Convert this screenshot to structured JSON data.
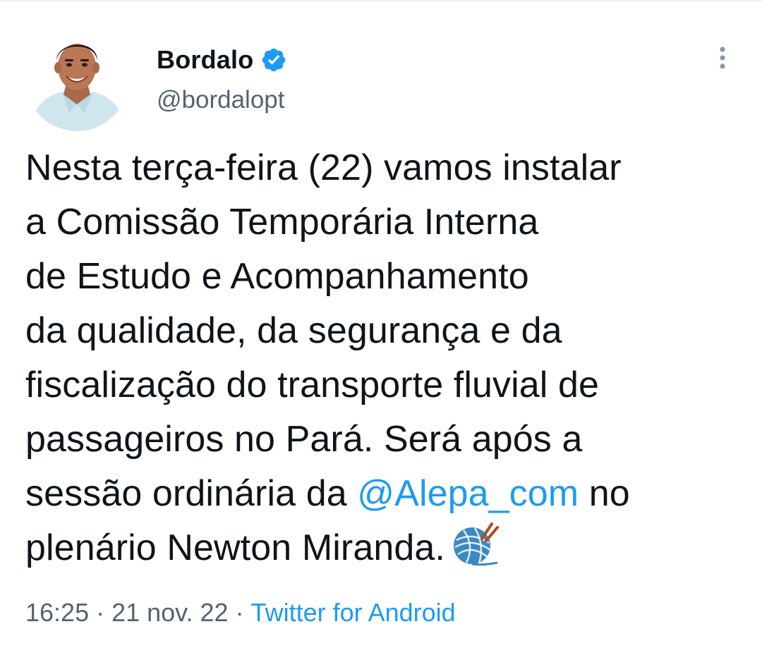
{
  "tweet": {
    "author": {
      "display_name": "Bordalo",
      "handle": "@bordalopt",
      "verified": true,
      "avatar_icon": "profile-photo"
    },
    "text_lines": [
      "Nesta terça-feira (22) vamos instalar",
      "a Comissão Temporária Interna",
      "de Estudo e Acompanhamento",
      "da qualidade, da segurança e da",
      "fiscalização do transporte fluvial de",
      "passageiros no Pará. Será após a",
      "sessão ordinária da ",
      "plenário Newton Miranda."
    ],
    "mention": "@Alepa_com",
    "after_mention": " no",
    "emoji_icon": "yarn-ball-icon",
    "time": "16:25",
    "date": "21 nov. 22",
    "separator": "·",
    "source": "Twitter for Android",
    "more_icon": "more-options-icon"
  },
  "colors": {
    "link": "#1d9bf0",
    "text": "#0f1419",
    "secondary": "#536471",
    "verified": "#1d9bf0"
  }
}
